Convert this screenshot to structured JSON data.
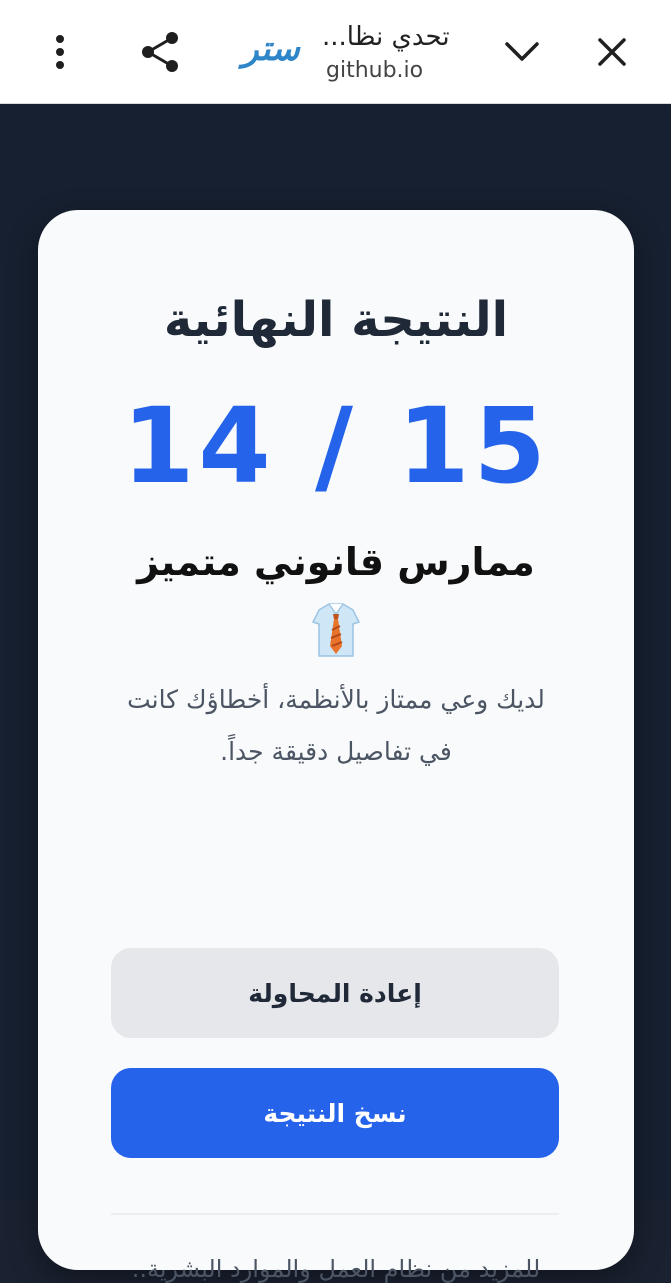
{
  "browser": {
    "tab_title": "تحدي نظا...",
    "url": "github.io",
    "site_logo_text": "ستر",
    "icons": [
      "more-vert-icon",
      "share-icon",
      "chevron-down-icon",
      "close-icon"
    ]
  },
  "result": {
    "heading": "النتيجة النهائية",
    "score": "14 / 15",
    "rank": "ممارس قانوني متميز",
    "rank_emoji": "shirt-tie-emoji",
    "description": "لديك وعي ممتاز بالأنظمة، أخطاؤك كانت في تفاصيل دقيقة جداً."
  },
  "actions": {
    "retry_label": "إعادة المحاولة",
    "copy_label": "نسخ النتيجة"
  },
  "footer": {
    "text": "للمزيد من نظام العمل والموارد البشرية.."
  },
  "colors": {
    "accent": "#2563eb",
    "background": "#172030",
    "card": "#f9fafb"
  }
}
